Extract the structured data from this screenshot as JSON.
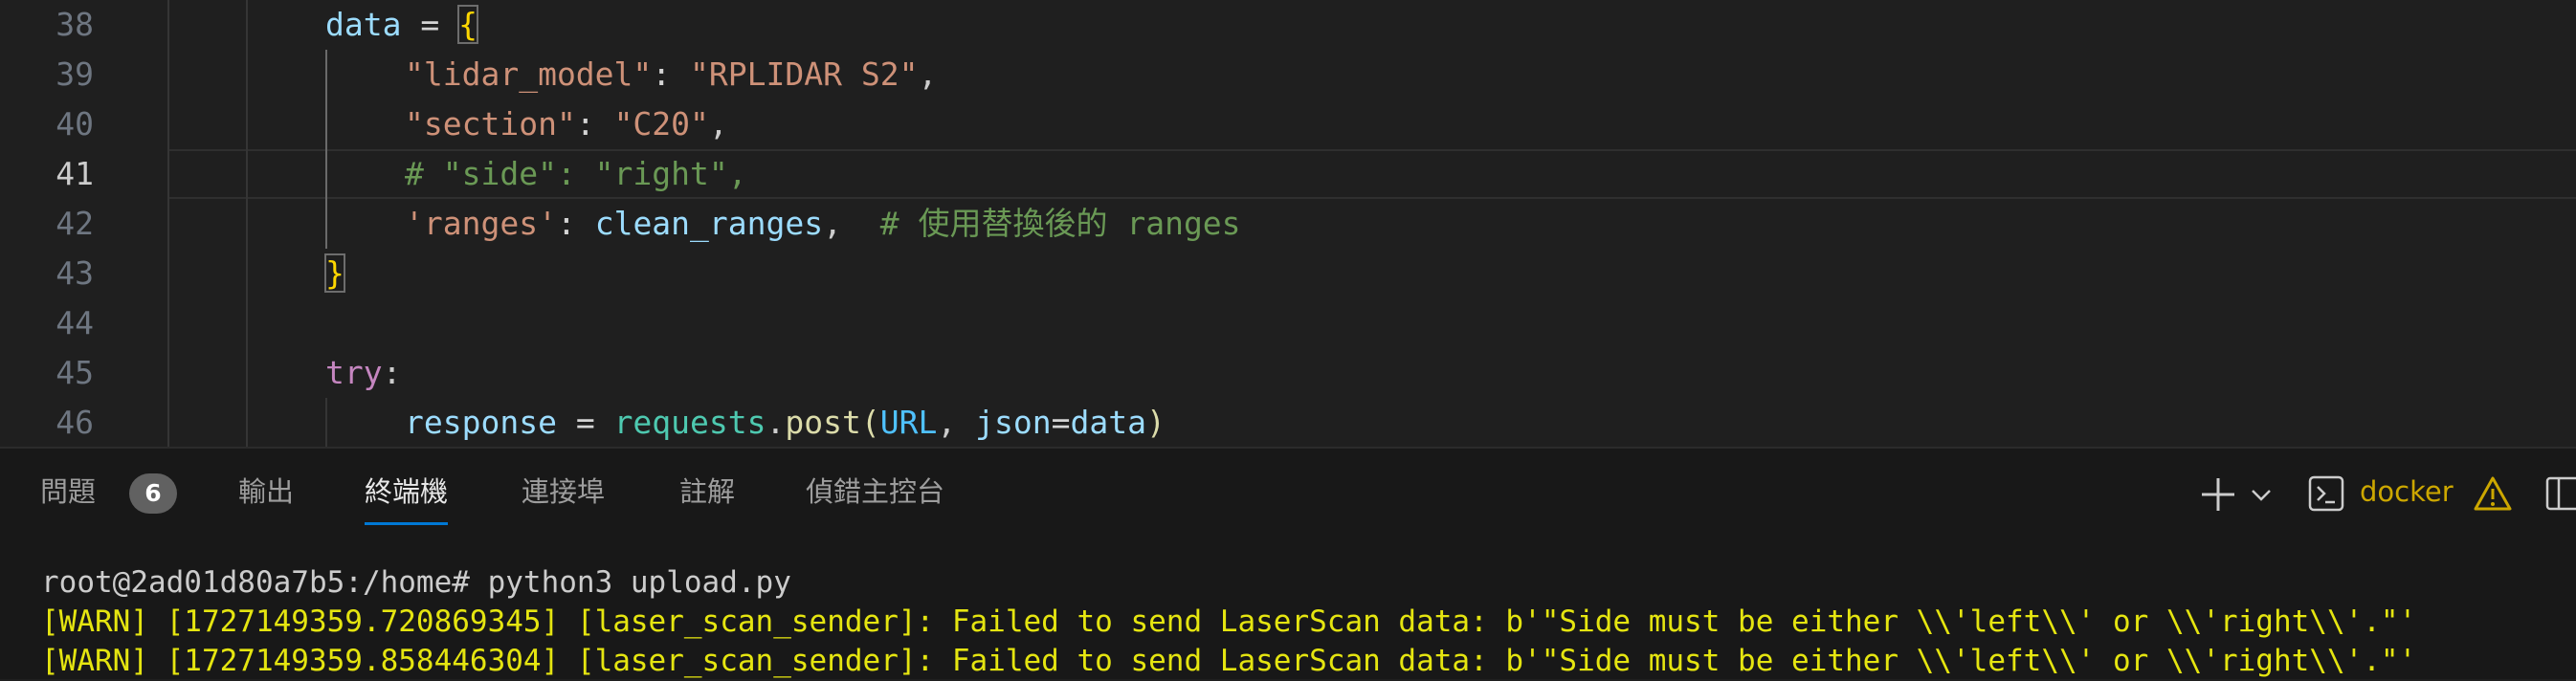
{
  "editor": {
    "lines": [
      {
        "num": "38"
      },
      {
        "num": "39"
      },
      {
        "num": "40"
      },
      {
        "num": "41"
      },
      {
        "num": "42"
      },
      {
        "num": "43"
      },
      {
        "num": "44"
      },
      {
        "num": "45"
      },
      {
        "num": "46"
      }
    ],
    "code": {
      "l38": [
        "data",
        " = ",
        "{"
      ],
      "l39": [
        "\"lidar_model\"",
        ": ",
        "\"RPLIDAR S2\"",
        ","
      ],
      "l40": [
        "\"section\"",
        ": ",
        "\"C20\"",
        ","
      ],
      "l41": [
        "# \"side\": \"right\","
      ],
      "l42": [
        "'ranges'",
        ": ",
        "clean_ranges",
        ",  ",
        "# 使用替換後的 ranges"
      ],
      "l43": [
        "}"
      ],
      "l45": [
        "try",
        ":"
      ],
      "l46": [
        "response",
        " = ",
        "requests",
        ".",
        "post",
        "(",
        "URL",
        ", ",
        "json",
        "=",
        "data",
        ")"
      ]
    }
  },
  "panel": {
    "tabs": [
      {
        "label": "問題"
      },
      {
        "label": "輸出"
      },
      {
        "label": "終端機"
      },
      {
        "label": "連接埠"
      },
      {
        "label": "註解"
      },
      {
        "label": "偵錯主控台"
      }
    ],
    "problems_count": "6",
    "terminal_profile": "docker",
    "terminal_lines": [
      "root@2ad01d80a7b5:/home# python3 upload.py",
      "[WARN] [1727149359.720869345] [laser_scan_sender]: Failed to send LaserScan data: b'\"Side must be either \\\\'left\\\\' or \\\\'right\\\\'.\"'",
      "[WARN] [1727149359.858446304] [laser_scan_sender]: Failed to send LaserScan data: b'\"Side must be either \\\\'left\\\\' or \\\\'right\\\\'.\"'"
    ]
  },
  "colors": {
    "accent": "#0078d4",
    "warning": "#cca700",
    "terminal_warn": "#e5e510"
  }
}
